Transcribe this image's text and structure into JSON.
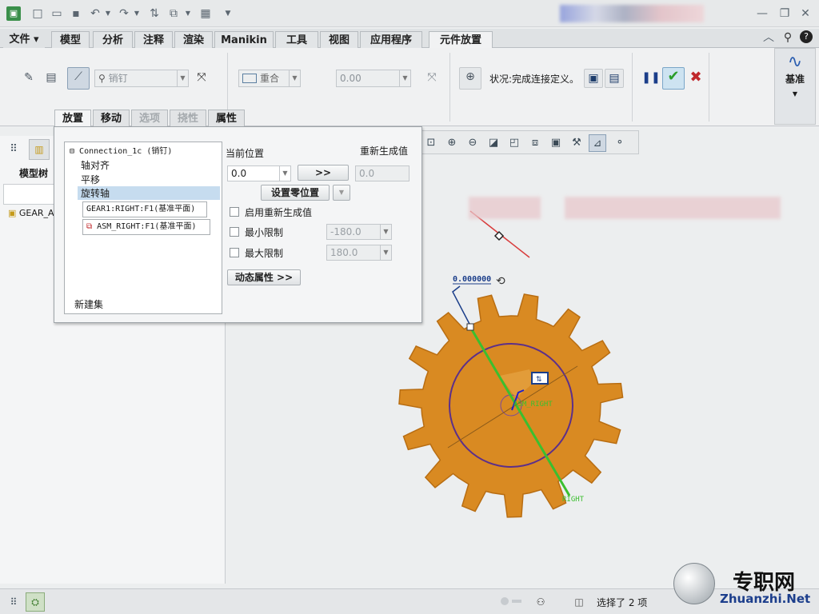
{
  "menu": {
    "file": "文件",
    "tabs": [
      "模型",
      "分析",
      "注释",
      "渲染",
      "Manikin",
      "工具",
      "视图",
      "应用程序",
      "元件放置"
    ]
  },
  "ribbon": {
    "constraint_type": "销钉",
    "align_type": "重合",
    "offset_value": "0.00",
    "status_text": "状况:完成连接定义。",
    "datum_label": "基准"
  },
  "panel": {
    "tabs": [
      "放置",
      "移动",
      "选项",
      "挠性",
      "属性"
    ],
    "tree": {
      "root": "Connection_1c (销钉)",
      "items": [
        "轴对齐",
        "平移",
        "旋转轴"
      ],
      "refs": [
        "GEAR1:RIGHT:F1(基准平面)",
        "ASM_RIGHT:F1(基准平面)"
      ],
      "new_set": "新建集"
    },
    "current_position_label": "当前位置",
    "regen_value_label": "重新生成值",
    "current_position_value": "0.0",
    "arrow_button": ">>",
    "regen_value": "0.0",
    "set_zero_button": "设置零位置",
    "enable_regen": "启用重新生成值",
    "min_limit": "最小限制",
    "min_value": "-180.0",
    "max_limit": "最大限制",
    "max_value": "180.0",
    "dynamic_props_button": "动态属性 >>"
  },
  "left_panel": {
    "tree_title": "模型树",
    "item": "GEAR_A"
  },
  "graphics": {
    "dim_value": "0.000000",
    "plane1": "ASM_RIGHT",
    "plane2": "RIGHT"
  },
  "status": {
    "selected": "选择了 2 项"
  },
  "watermark": {
    "cn": "专职网",
    "en": "Zhuanzhi.Net"
  },
  "colors": {
    "gear": "#d98a22",
    "gear_edge": "#b86d12",
    "axis_green": "#3bbf2f",
    "circle_purple": "#5c2f8a",
    "confirm_green": "#2a9d2a",
    "cancel_red": "#c0282c"
  }
}
